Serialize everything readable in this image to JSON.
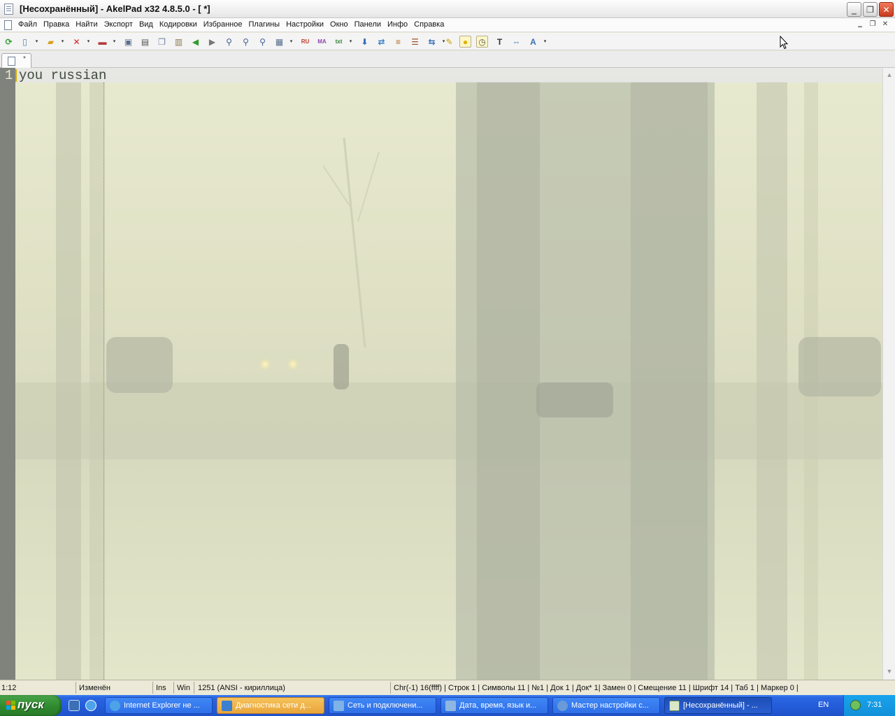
{
  "window": {
    "title": "[Несохранённый] - AkelPad x32 4.8.5.0 - [ *]",
    "caption_buttons": {
      "minimize": "‗",
      "restore": "❐",
      "close": "✕"
    }
  },
  "menu": {
    "items": [
      "Файл",
      "Правка",
      "Найти",
      "Экспорт",
      "Вид",
      "Кодировки",
      "Избранное",
      "Плагины",
      "Настройки",
      "Окно",
      "Панели",
      "Инфо",
      "Справка"
    ],
    "mdi_buttons": {
      "minimize": "‗",
      "restore": "❐",
      "close": "✕"
    }
  },
  "toolbar": {
    "icons": [
      "refresh-icon",
      "new-file-icon",
      "open-folder-icon",
      "delete-icon",
      "package-icon",
      "settings-window-icon",
      "print-icon",
      "copy-icon",
      "paste-icon",
      "back-arrow-icon",
      "forward-arrow-icon",
      "find-icon",
      "find-next-icon",
      "replace-regex-icon",
      "window-split-icon",
      "translit-icon",
      "case-icon",
      "format-icon",
      "download-icon",
      "convert-icon",
      "sort-icon",
      "stack-icon",
      "swap-icon",
      "pencil-icon",
      "bulb-icon",
      "clock-icon",
      "text-icon",
      "resize-icon",
      "font-icon"
    ],
    "labels": {
      "translit": "RU\nEN",
      "case": "MA\nMa",
      "format": "txt"
    }
  },
  "tabs": [
    {
      "label": "*"
    }
  ],
  "editor": {
    "line_numbers": [
      "1"
    ],
    "lines": [
      "you russian"
    ]
  },
  "status": {
    "position": "1:12",
    "modified": "Изменён",
    "insert_mode": "Ins",
    "newline": "Win",
    "encoding": "1251  (ANSI - кириллица)",
    "info": "Chr(-1) 16(ffff) | Строк 1 | Символы 11 | №1 | Док 1 | Док* 1| Замен 0 | Смещение 11 | Шрифт 14 | Таб 1 | Маркер 0 |"
  },
  "taskbar": {
    "start_label": "пуск",
    "tasks": [
      {
        "label": "Internet Explorer не ...",
        "icon": "ie-icon",
        "active": false
      },
      {
        "label": "Диагностика сети д...",
        "icon": "network-diagnostics-icon",
        "active": false
      },
      {
        "label": "Сеть и подключени...",
        "icon": "network-connections-icon",
        "active": false
      },
      {
        "label": "Дата, время, язык и...",
        "icon": "control-panel-icon",
        "active": false
      },
      {
        "label": "Мастер настройки с...",
        "icon": "wizard-icon",
        "active": false
      },
      {
        "label": "[Несохранённый] - ...",
        "icon": "akelpad-icon",
        "active": true
      }
    ],
    "language": "EN",
    "clock": "7:31"
  }
}
